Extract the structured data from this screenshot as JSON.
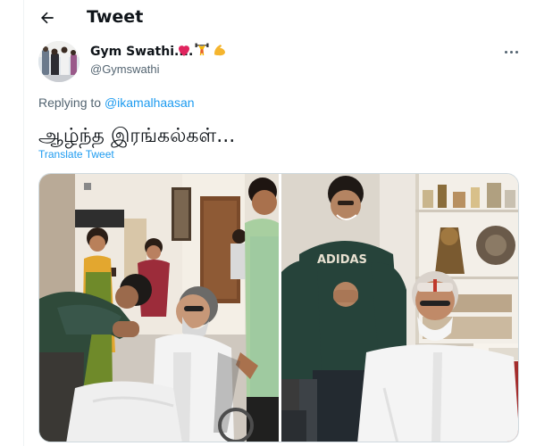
{
  "header": {
    "title": "Tweet",
    "back_icon": "arrow-left-icon"
  },
  "tweet": {
    "author_name": "Gym Swathi....",
    "author_emoji": [
      "red-heart-icon",
      "weightlifter-icon",
      "flexed-biceps-icon"
    ],
    "handle": "@Gymswathi",
    "replying_prefix": "Replying to",
    "replying_to": "@ikamalhaasan",
    "text": "ஆழ்ந்த இரங்கல்கள்...",
    "translate_label": "Translate Tweet"
  },
  "left_photo": {
    "sweatshirt_text": ""
  },
  "right_photo": {
    "sweatshirt_text": "ADIDAS"
  },
  "colors": {
    "accent": "#1d9bf0",
    "secondary_text": "#536471",
    "primary_text": "#0f1419",
    "border": "#cfd9de"
  }
}
